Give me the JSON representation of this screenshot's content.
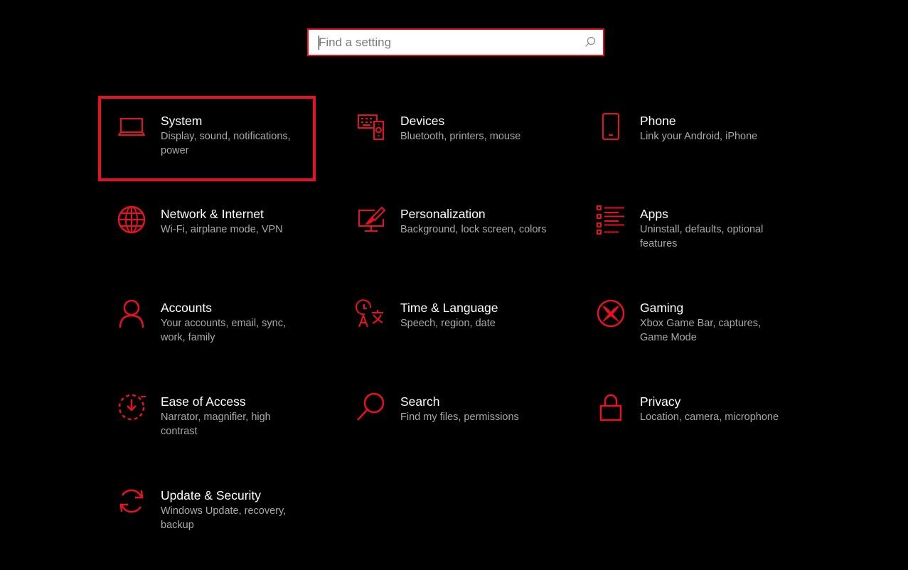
{
  "search": {
    "placeholder": "Find a setting"
  },
  "accent_color": "#e81123",
  "tiles": [
    {
      "title": "System",
      "desc": "Display, sound, notifications, power",
      "icon": "laptop-icon",
      "selected": true
    },
    {
      "title": "Devices",
      "desc": "Bluetooth, printers, mouse",
      "icon": "devices-icon"
    },
    {
      "title": "Phone",
      "desc": "Link your Android, iPhone",
      "icon": "phone-icon"
    },
    {
      "title": "Network & Internet",
      "desc": "Wi-Fi, airplane mode, VPN",
      "icon": "globe-icon"
    },
    {
      "title": "Personalization",
      "desc": "Background, lock screen, colors",
      "icon": "paint-icon"
    },
    {
      "title": "Apps",
      "desc": "Uninstall, defaults, optional features",
      "icon": "apps-list-icon"
    },
    {
      "title": "Accounts",
      "desc": "Your accounts, email, sync, work, family",
      "icon": "person-icon"
    },
    {
      "title": "Time & Language",
      "desc": "Speech, region, date",
      "icon": "time-language-icon"
    },
    {
      "title": "Gaming",
      "desc": "Xbox Game Bar, captures, Game Mode",
      "icon": "xbox-icon"
    },
    {
      "title": "Ease of Access",
      "desc": "Narrator, magnifier, high contrast",
      "icon": "ease-of-access-icon"
    },
    {
      "title": "Search",
      "desc": "Find my files, permissions",
      "icon": "search-icon"
    },
    {
      "title": "Privacy",
      "desc": "Location, camera, microphone",
      "icon": "lock-icon"
    },
    {
      "title": "Update & Security",
      "desc": "Windows Update, recovery, backup",
      "icon": "sync-icon"
    }
  ]
}
